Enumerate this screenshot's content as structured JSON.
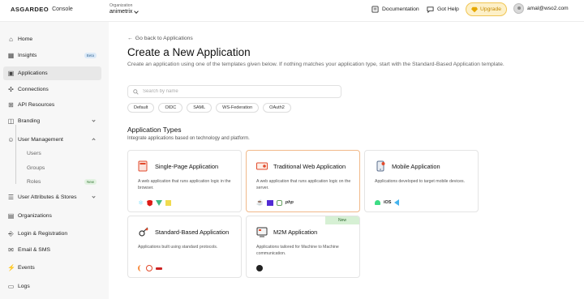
{
  "header": {
    "brand": "ASGARDEO",
    "console": "Console",
    "org_label": "Organization",
    "org_value": "animetrix",
    "documentation": "Documentation",
    "help": "Got Help",
    "upgrade": "Upgrade",
    "user_email": "amal@wso2.com"
  },
  "sidebar": {
    "home": "Home",
    "insights": "Insights",
    "insights_badge": "Beta",
    "applications": "Applications",
    "connections": "Connections",
    "api_resources": "API Resources",
    "branding": "Branding",
    "user_management": "User Management",
    "users": "Users",
    "groups": "Groups",
    "roles": "Roles",
    "roles_badge": "New",
    "user_attributes": "User Attributes & Stores",
    "organizations": "Organizations",
    "login_registration": "Login & Registration",
    "email_sms": "Email & SMS",
    "events": "Events",
    "logs": "Logs"
  },
  "main": {
    "back": "Go back to Applications",
    "title": "Create a New Application",
    "description": "Create an application using one of the templates given below. If nothing matches your application type, start with the Standard-Based Application template.",
    "search_placeholder": "Search by name",
    "filters": [
      "Default",
      "OIDC",
      "SAML",
      "WS-Federation",
      "OAuth2"
    ],
    "section_title": "Application Types",
    "section_desc": "Integrate applications based on technology and platform."
  },
  "cards": {
    "spa": {
      "title": "Single-Page Application",
      "desc": "A web application that runs application logic in the browser."
    },
    "traditional": {
      "title": "Traditional Web Application",
      "desc": "A web application that runs application logic on the server.",
      "php": "php"
    },
    "mobile": {
      "title": "Mobile Application",
      "desc": "Applications developed to target mobile devices.",
      "ios": "iOS"
    },
    "standard": {
      "title": "Standard-Based Application",
      "desc": "Applications built using standard protocols."
    },
    "m2m": {
      "title": "M2M Application",
      "badge": "New",
      "desc": "Applications tailored for Machine to Machine communication."
    }
  },
  "colors": {
    "accent_orange": "#f1b98a",
    "upgrade_bg": "#fdf0c8",
    "active_nav": "#e8e8e8"
  }
}
